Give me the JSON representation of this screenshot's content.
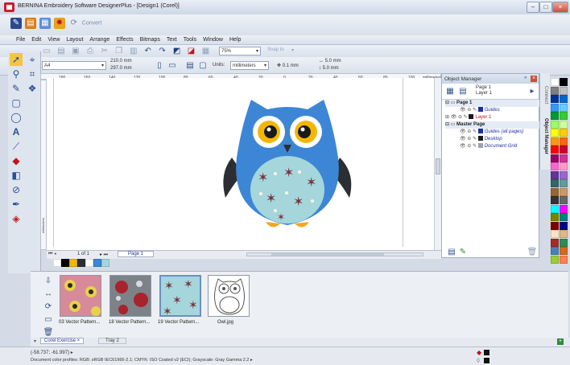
{
  "window": {
    "title": "BERNINA Embroidery Software DesignerPlus - [Design1 (Corel)]"
  },
  "quick_toolbar": {
    "convert_label": "Convert"
  },
  "menu": [
    "File",
    "Edit",
    "View",
    "Layout",
    "Arrange",
    "Effects",
    "Bitmaps",
    "Text",
    "Tools",
    "Window",
    "Help"
  ],
  "standard_bar": {
    "zoom": "75%",
    "snap": "Snap to"
  },
  "property_bar": {
    "paper": "A4",
    "width": "210.0 mm",
    "height": "297.0 mm",
    "units_label": "Units:",
    "units": "millimeters",
    "nudge": "0.1 mm",
    "dup_x": "5.0 mm",
    "dup_y": "5.0 mm"
  },
  "ruler": {
    "ticks": [
      "180",
      "160",
      "140",
      "120",
      "100",
      "80",
      "60",
      "40",
      "20",
      "0",
      "20",
      "40",
      "60",
      "80",
      "100"
    ],
    "unit": "millimeters",
    "vertical_unit": "millimeters"
  },
  "page_nav": {
    "pages": "1 of 1",
    "tab": "Page 1"
  },
  "object_manager": {
    "title": "Object Manager",
    "header_page": "Page 1",
    "header_layer": "Layer 1",
    "rows": [
      {
        "label": "Page 1",
        "color": "#1a1a1a",
        "bold": true
      },
      {
        "label": "Guides",
        "color": "#1f2fa3",
        "bold": false
      },
      {
        "label": "Layer 1",
        "color": "#c0161b",
        "bold": false
      },
      {
        "label": "Master Page",
        "color": "#1a1a1a",
        "bold": true
      },
      {
        "label": "Guides (all pages)",
        "color": "#1f2fa3",
        "bold": false
      },
      {
        "label": "Desktop",
        "color": "#1f2fa3",
        "bold": false
      },
      {
        "label": "Document Grid",
        "color": "#1f2fa3",
        "bold": false
      }
    ],
    "side_tabs": [
      "Connect",
      "Object Manager"
    ]
  },
  "tray": {
    "items": [
      {
        "caption": "03 Vector Pattern..."
      },
      {
        "caption": "18 Vector Pattern..."
      },
      {
        "caption": "19 Vector Pattern..."
      },
      {
        "caption": "Owl.jpg"
      }
    ],
    "tabs": [
      "Corel Exercise",
      "Tray 2"
    ]
  },
  "status": {
    "coords": "(-58.737; -61.997)",
    "profiles": "Document color profiles: RGB: sRGB IEC61966-2.1; CMYK: ISO Coated v2 (ECI); Grayscale: Gray Gamma 2.2"
  },
  "colors": {
    "owl_body": "#3d86d6",
    "owl_belly": "#a4d6db",
    "eye_ring": "#f2b705",
    "wing": "#2b2f33",
    "star": "#7a3340",
    "feet": "#f2a91e"
  }
}
